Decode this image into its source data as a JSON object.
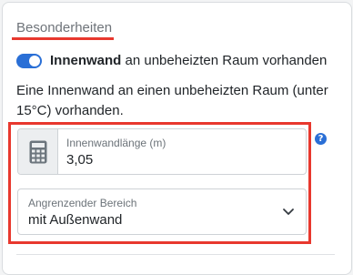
{
  "section": {
    "title": "Besonderheiten"
  },
  "toggle": {
    "label_bold": "Innenwand",
    "label_rest": " an unbeheizten Raum vorhanden",
    "checked": true,
    "color": "#2a6fd6"
  },
  "description": "Eine Innenwand an einen unbeheizten Raum (unter 15°C) vorhanden.",
  "length_field": {
    "label": "Innenwandlänge (m)",
    "value": "3,05",
    "icon": "calculator-icon"
  },
  "help": {
    "glyph": "?",
    "icon": "help-icon"
  },
  "area_select": {
    "label": "Angrenzender Bereich",
    "value": "mit Außenwand",
    "icon": "chevron-down-icon"
  },
  "colors": {
    "accent": "#e8382e",
    "primary": "#2a6fd6"
  }
}
